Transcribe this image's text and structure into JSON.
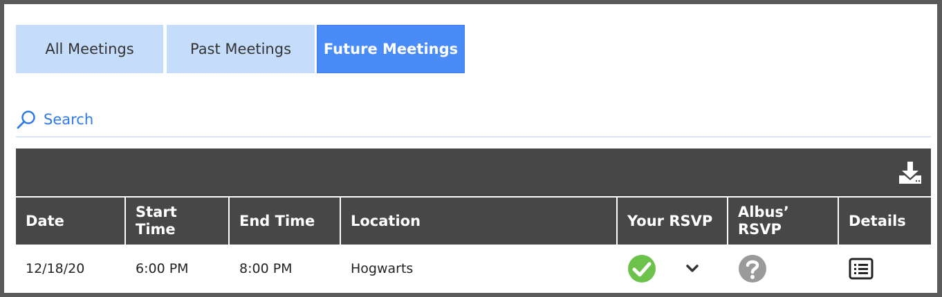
{
  "tabs": [
    {
      "label": "All Meetings"
    },
    {
      "label": "Past Meetings"
    },
    {
      "label": "Future Meetings"
    }
  ],
  "search": {
    "label": "Search"
  },
  "table": {
    "headers": [
      "Date",
      "Start Time",
      "End Time",
      "Location",
      "Your RSVP",
      "Albus’ RSVP",
      "Details"
    ],
    "rows": [
      {
        "date": "12/18/20",
        "start": "6:00 PM",
        "end": "8:00 PM",
        "location": "Hogwarts"
      }
    ]
  },
  "colors": {
    "active_tab": "#4a8cf7",
    "inactive_tab": "#c5dcfb",
    "header_bg": "#474747",
    "link": "#2f7ae5",
    "rsvp_yes": "#6cc24a",
    "rsvp_unknown": "#9a9a9a"
  },
  "icons": {
    "search": "search-icon",
    "download": "download-icon",
    "rsvp_yes": "checkmark-circle-icon",
    "rsvp_dropdown": "chevron-down-icon",
    "rsvp_unknown": "question-circle-icon",
    "details": "list-icon"
  }
}
